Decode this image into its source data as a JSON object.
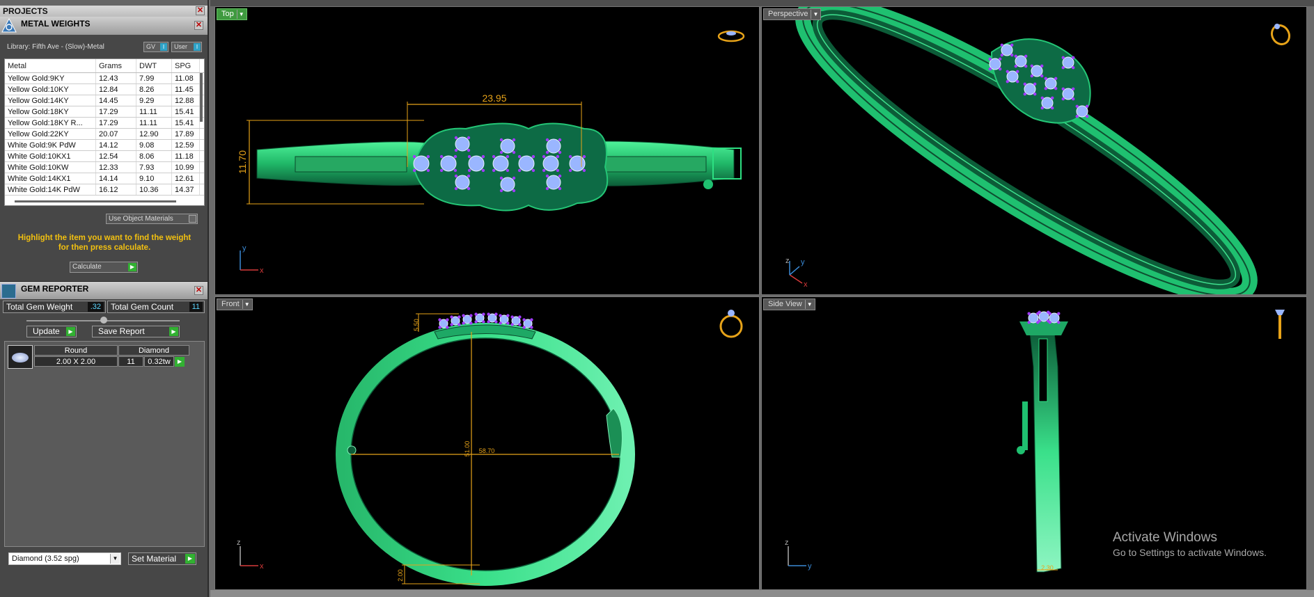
{
  "projects": {
    "title": "PROJECTS"
  },
  "metal_weights": {
    "title": "METAL WEIGHTS",
    "library": "Library: Fifth Ave - (Slow)-Metal",
    "toggle_gv": "GV",
    "toggle_user": "User",
    "columns": [
      "Metal",
      "Grams",
      "DWT",
      "SPG"
    ],
    "rows": [
      [
        "Yellow Gold:9KY",
        "12.43",
        "7.99",
        "11.08"
      ],
      [
        "Yellow Gold:10KY",
        "12.84",
        "8.26",
        "11.45"
      ],
      [
        "Yellow Gold:14KY",
        "14.45",
        "9.29",
        "12.88"
      ],
      [
        "Yellow Gold:18KY",
        "17.29",
        "11.11",
        "15.41"
      ],
      [
        "Yellow Gold:18KY R...",
        "17.29",
        "11.11",
        "15.41"
      ],
      [
        "Yellow Gold:22KY",
        "20.07",
        "12.90",
        "17.89"
      ],
      [
        "White Gold:9K PdW",
        "14.12",
        "9.08",
        "12.59"
      ],
      [
        "White Gold:10KX1",
        "12.54",
        "8.06",
        "11.18"
      ],
      [
        "White Gold:10KW",
        "12.33",
        "7.93",
        "10.99"
      ],
      [
        "White Gold:14KX1",
        "14.14",
        "9.10",
        "12.61"
      ],
      [
        "White Gold:14K PdW",
        "16.12",
        "10.36",
        "14.37"
      ]
    ],
    "use_object_materials": "Use Object Materials",
    "hint_line1": "Highlight the item you want to find the weight",
    "hint_line2": "for then press calculate.",
    "calculate": "Calculate"
  },
  "gem_reporter": {
    "title": "GEM REPORTER",
    "total_weight_label": "Total Gem Weight",
    "total_weight_value": ".32",
    "total_count_label": "Total Gem Count",
    "total_count_value": "11",
    "update": "Update",
    "save_report": "Save Report",
    "gem": {
      "shape": "Round",
      "material": "Diamond",
      "size": "2.00 X 2.00",
      "count": "11",
      "weight": "0.32tw"
    },
    "material_select": "Diamond    (3.52 spg)",
    "set_material": "Set Material"
  },
  "viewports": {
    "top": {
      "label": "Top",
      "dim_width": "23.95",
      "dim_height": "11.70"
    },
    "perspective": {
      "label": "Perspective"
    },
    "front": {
      "label": "Front",
      "dim_head": "5.50",
      "dim_inner_h": "51.00",
      "dim_inner_w": "58.70",
      "dim_band": "2.00"
    },
    "side": {
      "label": "Side View",
      "dim_thick": "2.30"
    }
  },
  "axis": {
    "x": "x",
    "y": "y",
    "z": "z"
  },
  "watermark": {
    "line1": "Activate Windows",
    "line2": "Go to Settings to activate Windows."
  },
  "colors": {
    "band": "#2fd67a",
    "band_dark": "#0e6e45",
    "gem": "#9ab6ff",
    "prong": "#a13cff",
    "dimension": "#e7a319",
    "active_view": "#3f9a3f",
    "hint": "#f2c010"
  }
}
